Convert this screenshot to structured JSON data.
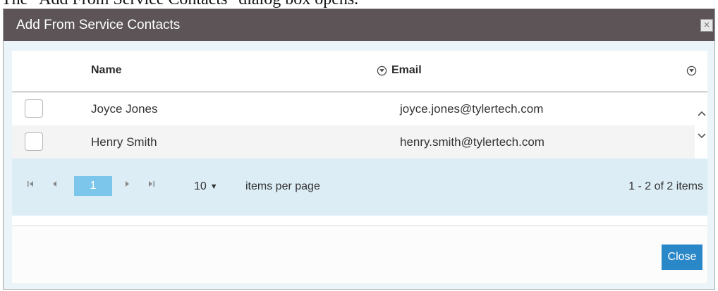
{
  "caption": "The \"Add From Service Contacts\" dialog box opens.",
  "dialog": {
    "title": "Add From Service Contacts",
    "close_icon": "close-icon",
    "close_glyph": "×"
  },
  "grid": {
    "columns": [
      {
        "label": "Name",
        "filter_icon": "filter-icon"
      },
      {
        "label": "Email",
        "filter_icon": "filter-icon"
      }
    ],
    "rows": [
      {
        "name": "Joyce Jones",
        "email": "joyce.jones@tylertech.com",
        "checked": false
      },
      {
        "name": "Henry Smith",
        "email": "henry.smith@tylertech.com",
        "checked": false
      }
    ]
  },
  "pager": {
    "first_glyph": "⏮",
    "prev_glyph": "◀",
    "current_page": "1",
    "next_glyph": "▶",
    "last_glyph": "⏭",
    "page_size": "10",
    "page_size_caret": "▼",
    "items_per_page_label": "items per page",
    "info": "1 - 2 of 2 items"
  },
  "footer": {
    "close_label": "Close"
  },
  "colors": {
    "titlebar": "#5c5456",
    "pager_bg": "#dcedf6",
    "current_page": "#7cc6ec",
    "close_button": "#2a88c9"
  }
}
